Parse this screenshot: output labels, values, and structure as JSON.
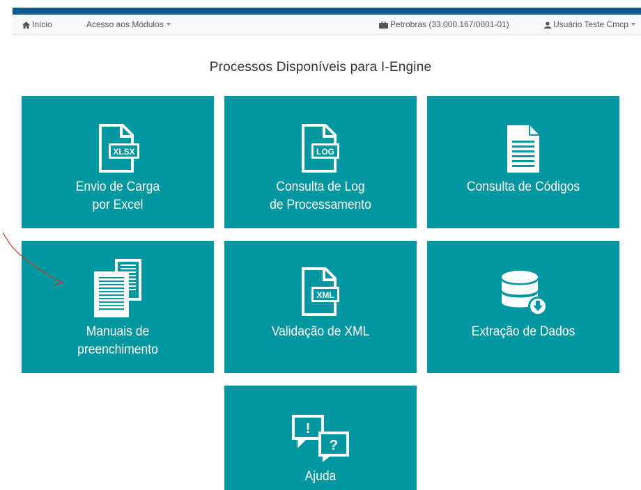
{
  "nav": {
    "home_label": "Início",
    "modules_label": "Acesso aos Módulos",
    "company_label": "Petrobras (33.000.167/0001-01)",
    "user_label": "Usuário Teste Cmcp"
  },
  "page": {
    "title": "Processos Disponíveis para I-Engine"
  },
  "tiles": [
    {
      "line1": "Envio de Carga",
      "line2": "por Excel",
      "icon": "xlsx-file-icon",
      "badge": "XLSX"
    },
    {
      "line1": "Consulta de Log",
      "line2": "de Processamento",
      "icon": "log-file-icon",
      "badge": "LOG"
    },
    {
      "line1": "Consulta de Códigos",
      "icon": "document-list-icon"
    },
    {
      "line1": "Manuais de",
      "line2": "preenchimento",
      "icon": "documents-icon"
    },
    {
      "line1": "Validação de XML",
      "icon": "xml-file-icon",
      "badge": "XML"
    },
    {
      "line1": "Extração de Dados",
      "icon": "database-download-icon"
    },
    {
      "line1": "Ajuda",
      "icon": "help-chat-icon",
      "badge1": "!",
      "badge2": "?"
    }
  ],
  "colors": {
    "tile": "#0097a0",
    "topbar": "#0f5a93",
    "annotation": "#c0392b"
  }
}
